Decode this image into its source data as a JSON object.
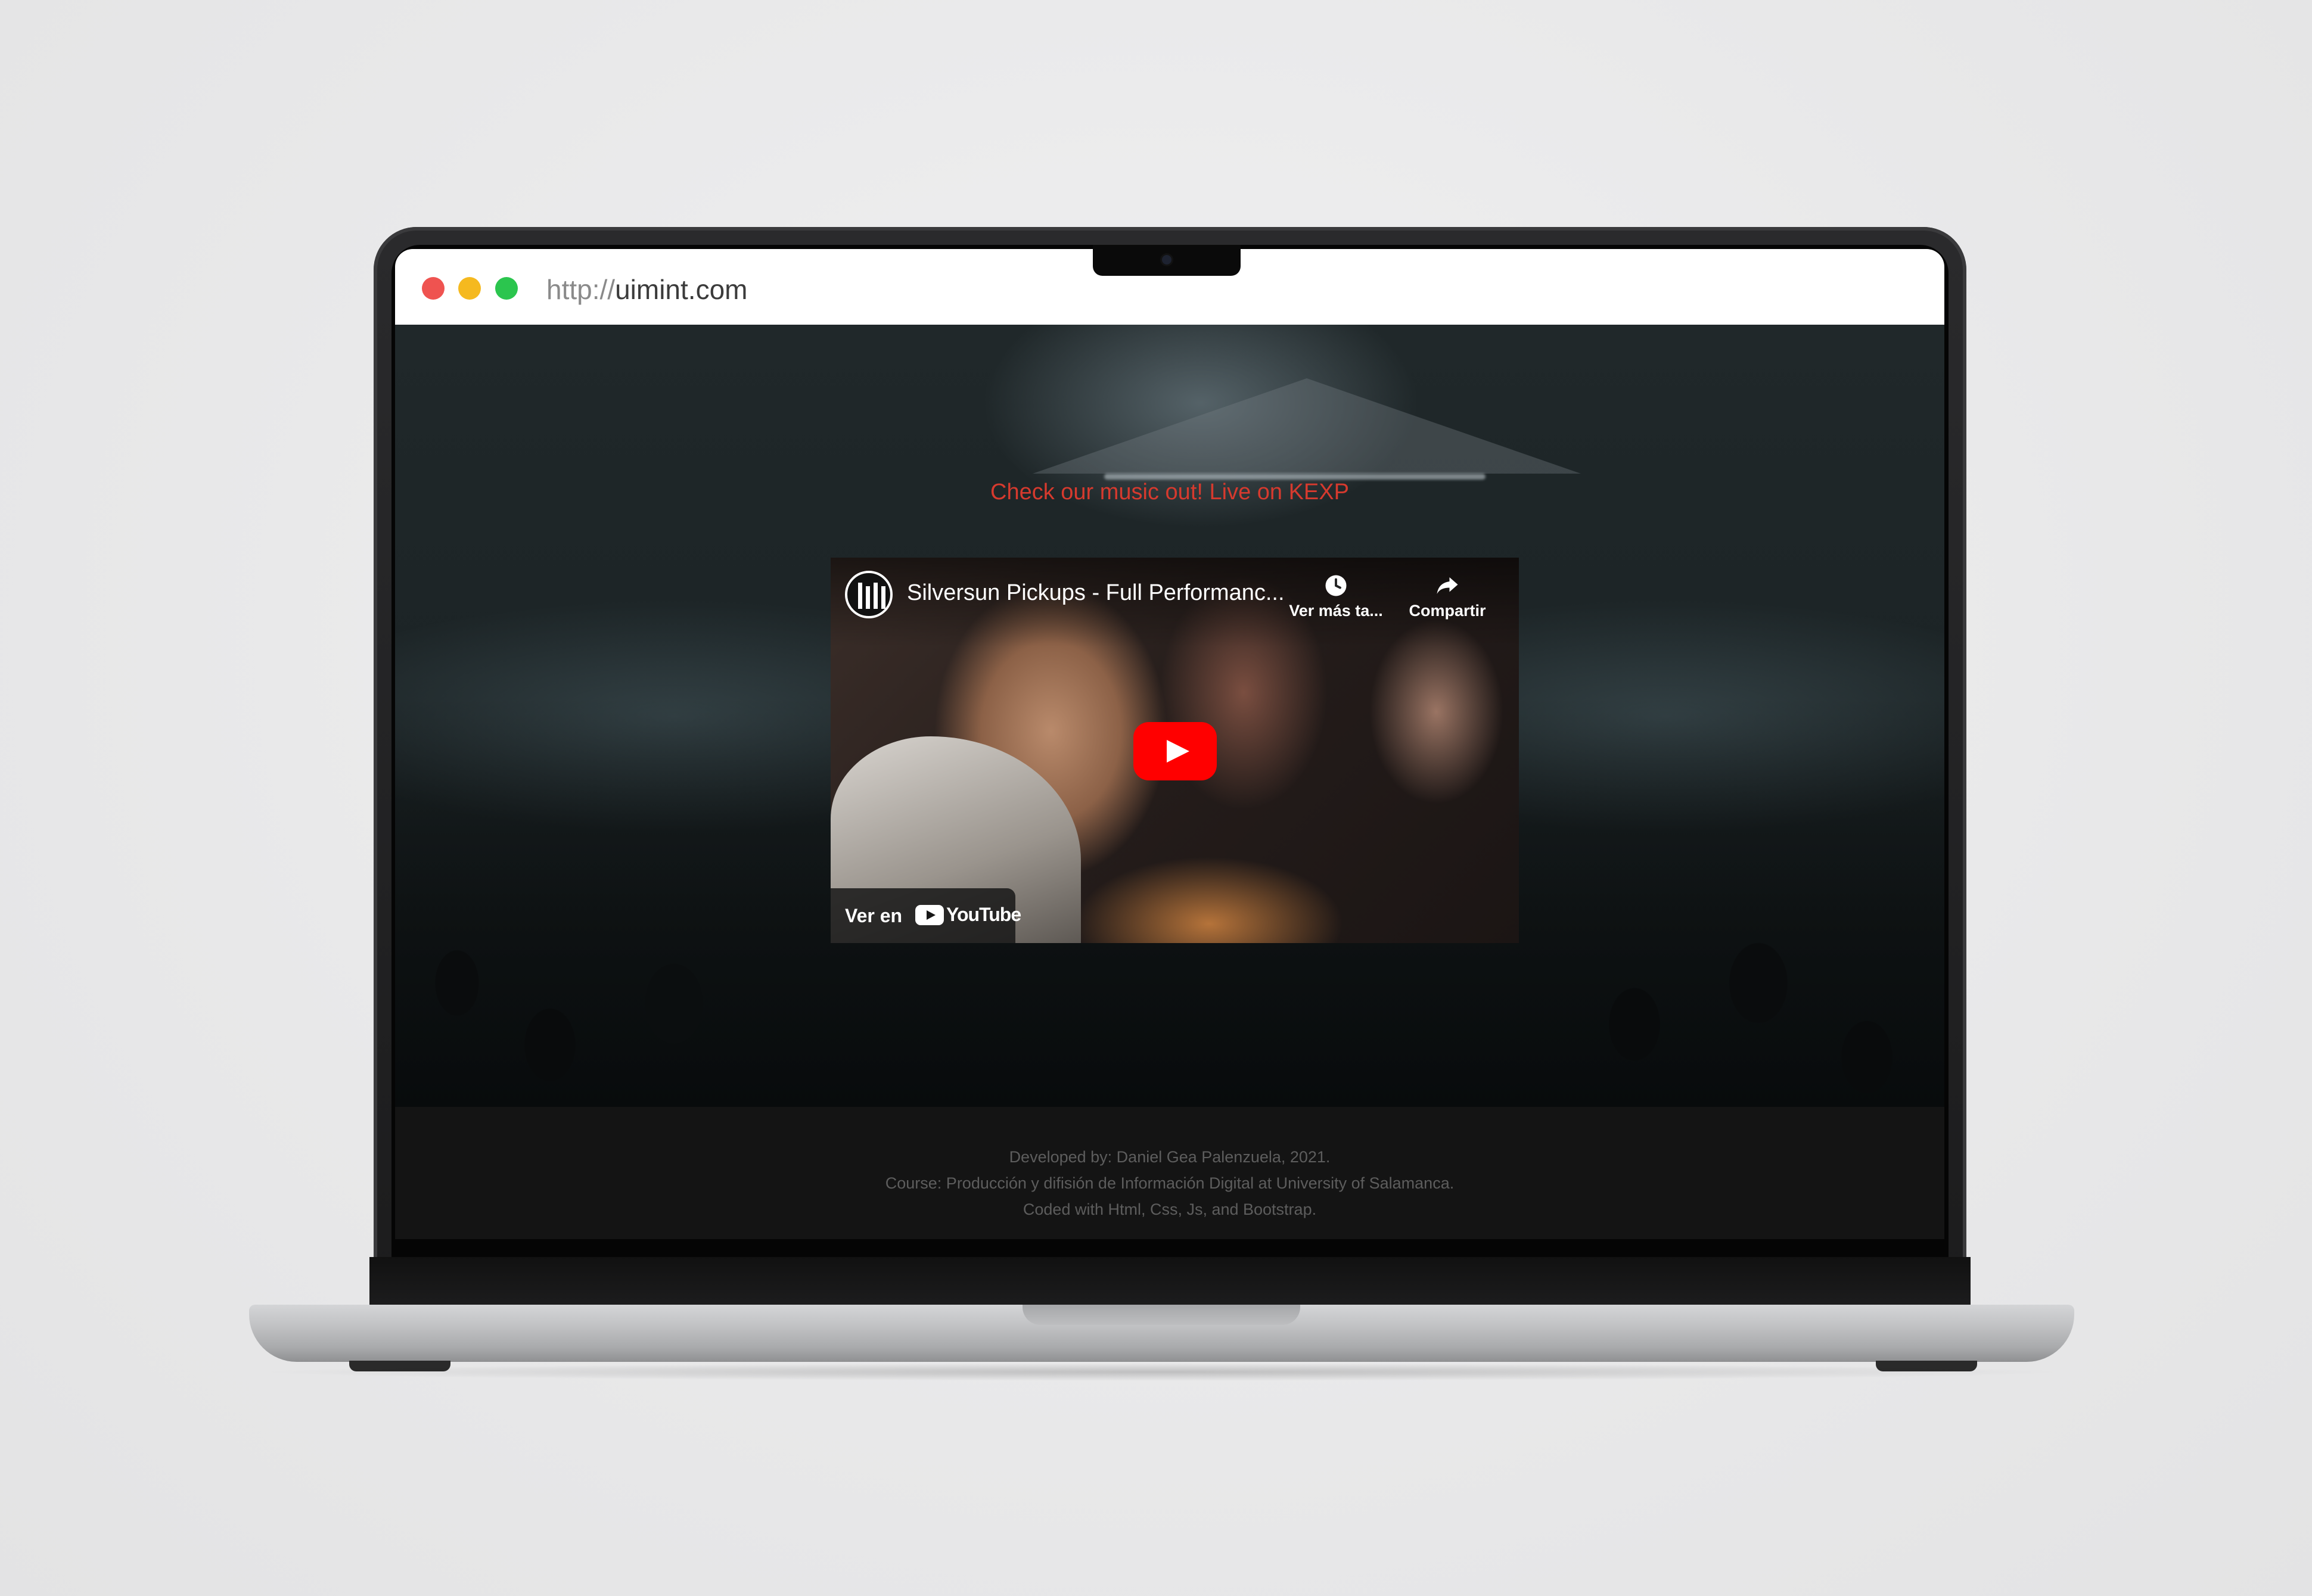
{
  "browser": {
    "url_protocol": "http://",
    "url_domain": "uimint.com"
  },
  "hero": {
    "heading": "Check our music out! Live on KEXP"
  },
  "video": {
    "title": "Silversun Pickups - Full Performanc...",
    "watch_later_label": "Ver más ta...",
    "share_label": "Compartir",
    "watch_on_label": "Ver en",
    "youtube_wordmark": "YouTube",
    "play_color": "#ff0000"
  },
  "footer": {
    "line1": "Developed by: Daniel Gea Palenzuela, 2021.",
    "line2": "Course: Producción y difisión de Información Digital at University of Salamanca.",
    "line3": "Coded with Html, Css, Js, and Bootstrap."
  },
  "colors": {
    "heading": "#d63a2e",
    "traffic_red": "#ef5350",
    "traffic_yellow": "#f5b91f",
    "traffic_green": "#2bc54e"
  },
  "icons": [
    "close-dot",
    "minimize-dot",
    "maximize-dot",
    "clock-icon",
    "share-icon",
    "play-icon",
    "youtube-logo-icon",
    "kexp-logo-icon"
  ]
}
